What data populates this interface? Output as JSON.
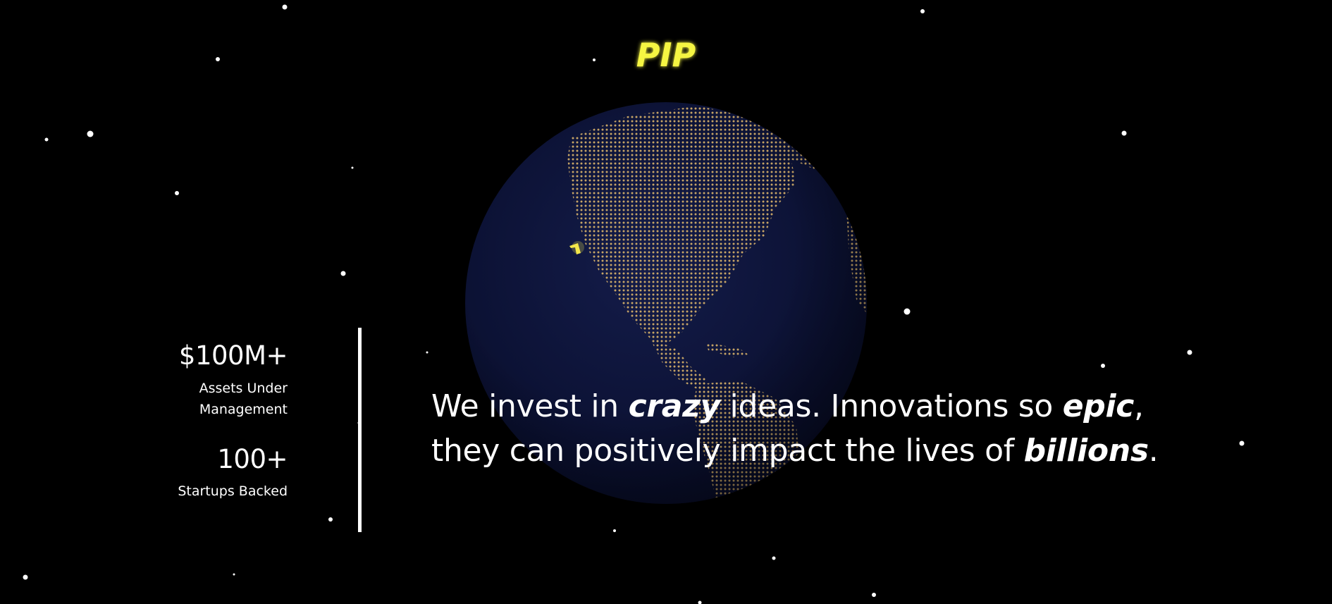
{
  "brand": {
    "logo_text": "PIP",
    "logo_color": "#f5f542"
  },
  "stats": [
    {
      "value": "$100M+",
      "label": "Assets Under\nManagement"
    },
    {
      "value": "100+",
      "label": "Startups Backed"
    }
  ],
  "tagline": {
    "part1": "We invest in ",
    "em1": "crazy",
    "part2": " ideas. Innovations so ",
    "em2": "epic",
    "part3": ", they can positively impact the lives of ",
    "em3": "billions",
    "part4": "."
  },
  "colors": {
    "background": "#000000",
    "globe_ocean": "#0d1438",
    "land_dots": "#d9b36a",
    "highlight": "#f5e94a",
    "text": "#ffffff"
  },
  "icons": [
    "globe-icon",
    "location-marker-icon",
    "star-field"
  ]
}
